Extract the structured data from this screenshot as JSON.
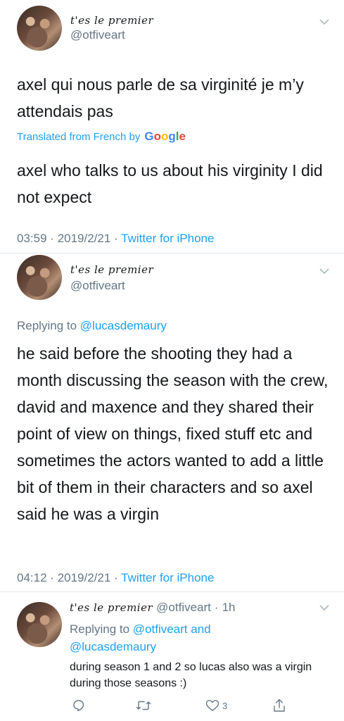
{
  "tweet1": {
    "display_name": "t'es le premier",
    "handle": "@otfiveart",
    "text": "axel qui nous parle de sa virginité je m’y attendais pas",
    "translated_prefix": "Translated from French by",
    "translated_brand": "Google",
    "translation": "axel who talks to us about his virginity I did not expect",
    "time": "03:59",
    "date": "2019/2/21",
    "source": "Twitter for iPhone"
  },
  "tweet2": {
    "display_name": "t'es le premier",
    "handle": "@otfiveart",
    "replying_prefix": "Replying to",
    "replying_to": "@lucasdemaury",
    "text": "he said before the shooting they had a month discussing the season with the crew, david and maxence and they shared their point of view on things, fixed stuff etc and sometimes the actors wanted to add a little bit of them in their characters and so axel said he was a virgin",
    "time": "04:12",
    "date": "2019/2/21",
    "source": "Twitter for iPhone"
  },
  "tweet3": {
    "display_name": "t'es le premier",
    "handle": "@otfiveart",
    "age": "1h",
    "replying_prefix": "Replying to",
    "replying_to_1": "@otfiveart",
    "replying_and": "and",
    "replying_to_2": "@lucasdemaury",
    "text": "during season 1 and 2 so lucas also was a virgin during those seasons :)",
    "like_count": "3"
  },
  "separator": "·",
  "colors": {
    "accent": "#1da1f2",
    "secondary": "#657786",
    "text": "#14171a"
  },
  "icons": [
    "chevron-down-icon",
    "reply-icon",
    "retweet-icon",
    "like-icon",
    "share-icon"
  ]
}
